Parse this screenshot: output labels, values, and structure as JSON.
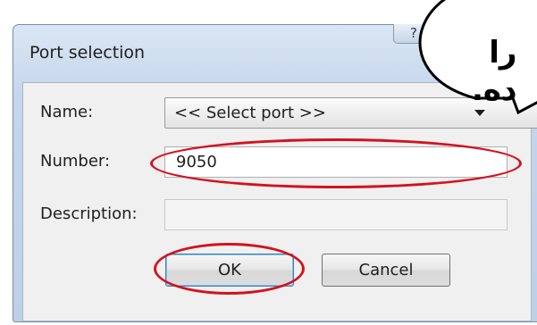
{
  "dialog": {
    "title": "Port selection",
    "help_label": "?",
    "fields": {
      "name_label": "Name:",
      "name_value": "<< Select port >>",
      "number_label": "Number:",
      "number_value": "9050",
      "description_label": "Description:",
      "description_value": ""
    },
    "buttons": {
      "ok_label": "OK",
      "cancel_label": "Cancel"
    }
  },
  "annotation": {
    "bubble_text": "را\nده."
  },
  "colors": {
    "annotation_red": "#d3121f",
    "ok_focus_border": "#3c7fb1"
  }
}
